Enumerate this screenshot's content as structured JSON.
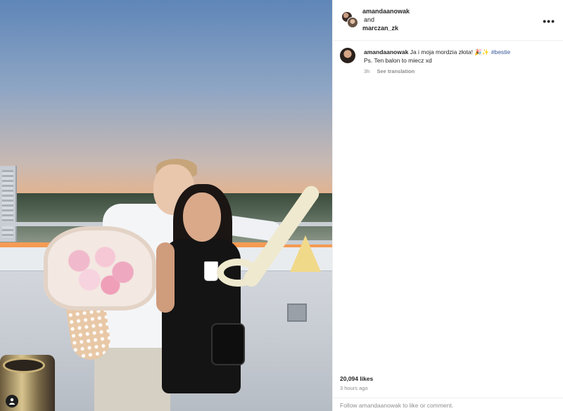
{
  "header": {
    "user1": "amandaanowak",
    "and": "and",
    "user2": "marczan_zk",
    "more_icon": "ellipsis-icon"
  },
  "caption": {
    "user": "amandaanowak",
    "text": "Ja i moja mordzia złota! 🎉✨",
    "hashtag": "#bestie",
    "line2": "Ps. Ten balon to miecz xd",
    "time": "3h",
    "see_translation": "See translation"
  },
  "stats": {
    "likes": "20,094 likes",
    "ago": "3 hours ago"
  },
  "footer": {
    "prompt": "Follow amandaanowak to like or comment."
  },
  "photo": {
    "tag_icon": "user-tag-icon"
  }
}
